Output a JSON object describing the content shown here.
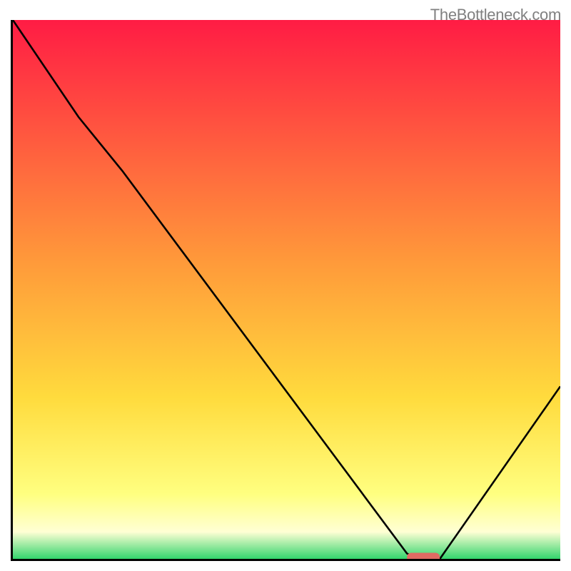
{
  "watermark": "TheBottleneck.com",
  "chart_data": {
    "type": "line",
    "title": "",
    "xlabel": "",
    "ylabel": "",
    "xlim": [
      0,
      100
    ],
    "ylim": [
      0,
      100
    ],
    "grid": false,
    "legend": false,
    "gradient_background": {
      "top": "#ff1c44",
      "mid": "#ffdb3d",
      "lower": "#ffff80",
      "bottom": "#33d46d"
    },
    "series": [
      {
        "name": "bottleneck-curve",
        "color": "#000000",
        "x": [
          0,
          12,
          20,
          72,
          74,
          78,
          100
        ],
        "y": [
          100,
          82,
          72,
          1,
          0,
          0,
          32
        ]
      }
    ],
    "marker": {
      "name": "optimal-zone",
      "color": "#e06a63",
      "x_start": 72,
      "x_end": 78,
      "y": 0.2
    }
  }
}
